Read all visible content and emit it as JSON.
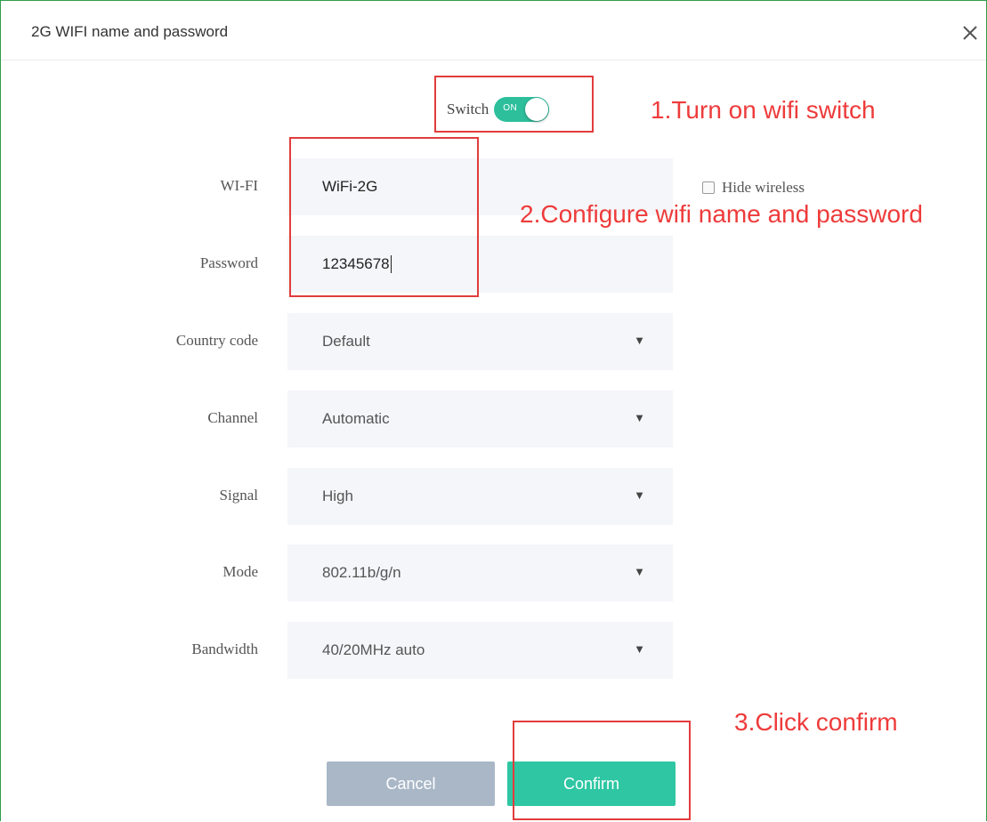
{
  "dialog": {
    "title": "2G WIFI name and password"
  },
  "switch": {
    "label": "Switch",
    "state_text": "ON",
    "on": true,
    "color": "#2dbf9c"
  },
  "fields": {
    "wifi": {
      "label": "WI-FI",
      "value": "WiFi-2G"
    },
    "password": {
      "label": "Password",
      "value": "12345678"
    },
    "country_code": {
      "label": "Country code",
      "value": "Default"
    },
    "channel": {
      "label": "Channel",
      "value": "Automatic"
    },
    "signal": {
      "label": "Signal",
      "value": "High"
    },
    "mode": {
      "label": "Mode",
      "value": "802.11b/g/n"
    },
    "bandwidth": {
      "label": "Bandwidth",
      "value": "40/20MHz auto"
    }
  },
  "hide_wireless": {
    "label": "Hide wireless",
    "checked": false
  },
  "buttons": {
    "cancel": "Cancel",
    "confirm": "Confirm"
  },
  "annotations": {
    "step1": "1.Turn on wifi switch",
    "step2": "2.Configure wifi name and password",
    "step3": "3.Click confirm",
    "color": "#ee3b3b"
  },
  "icons": {
    "close": "close-icon",
    "caret": "caret-down-icon"
  },
  "colors": {
    "accent": "#2ec6a3",
    "cancel": "#a9b7c7",
    "frame": "#2e9e4a"
  }
}
